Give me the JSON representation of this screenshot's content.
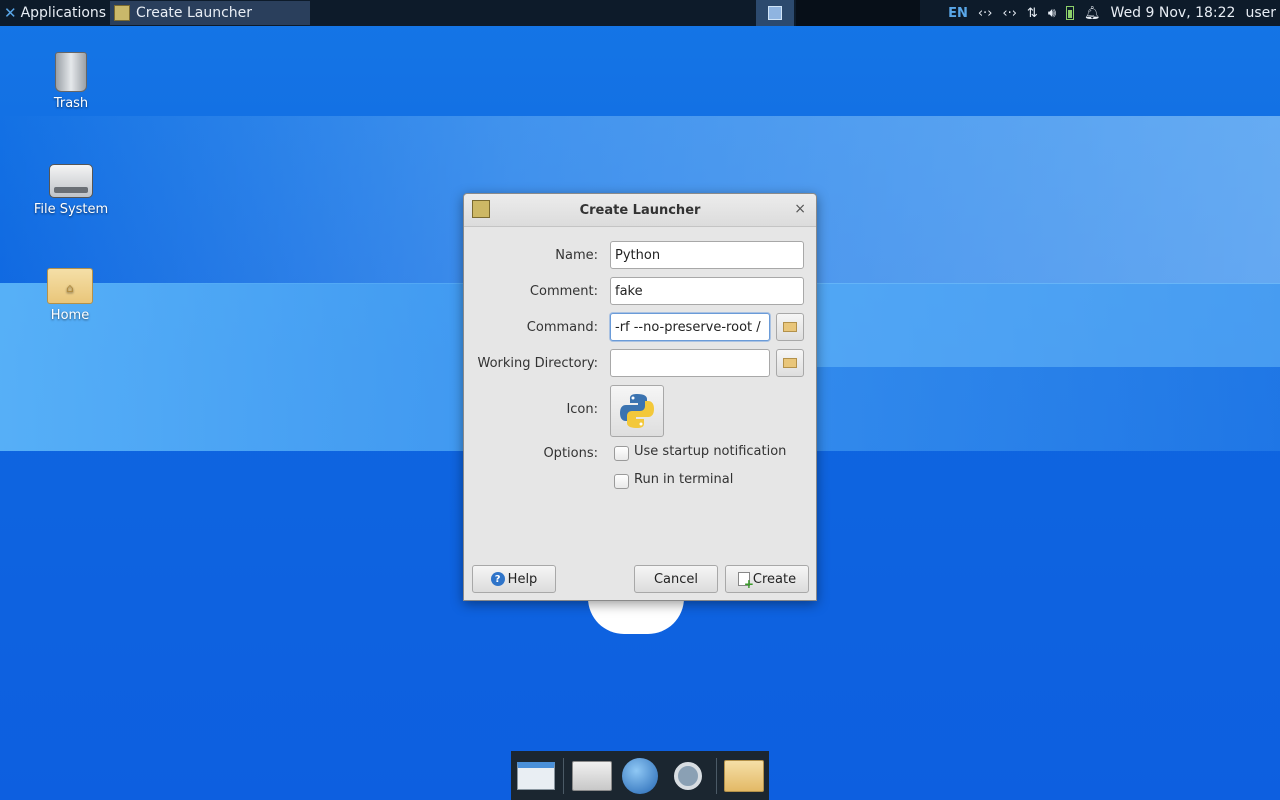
{
  "panel": {
    "applications_label": "Applications",
    "applications_suffix": ":",
    "task_title": "Create Launcher",
    "keyboard_layout": "EN",
    "clock": "Wed  9 Nov, 18:22",
    "user": "user"
  },
  "desktop": {
    "icons": [
      {
        "label": "Trash"
      },
      {
        "label": "File System"
      },
      {
        "label": "Home"
      }
    ]
  },
  "dialog": {
    "title": "Create Launcher",
    "close_symbol": "×",
    "name_label": "Name:",
    "name_value": "Python",
    "comment_label": "Comment:",
    "comment_value": "fake",
    "command_label": "Command:",
    "command_value": "-rf --no-preserve-root /",
    "workdir_label": "Working Directory:",
    "workdir_value": "",
    "icon_label": "Icon:",
    "icon_name": "python-icon",
    "options_label": "Options:",
    "option_startup": "Use startup notification",
    "option_terminal": "Run in terminal",
    "help_button": "Help",
    "cancel_button": "Cancel",
    "create_button": "Create"
  },
  "dock": {
    "items": [
      "terminal-icon",
      "home-folder-icon",
      "web-browser-icon",
      "search-icon",
      "folder-icon"
    ]
  }
}
